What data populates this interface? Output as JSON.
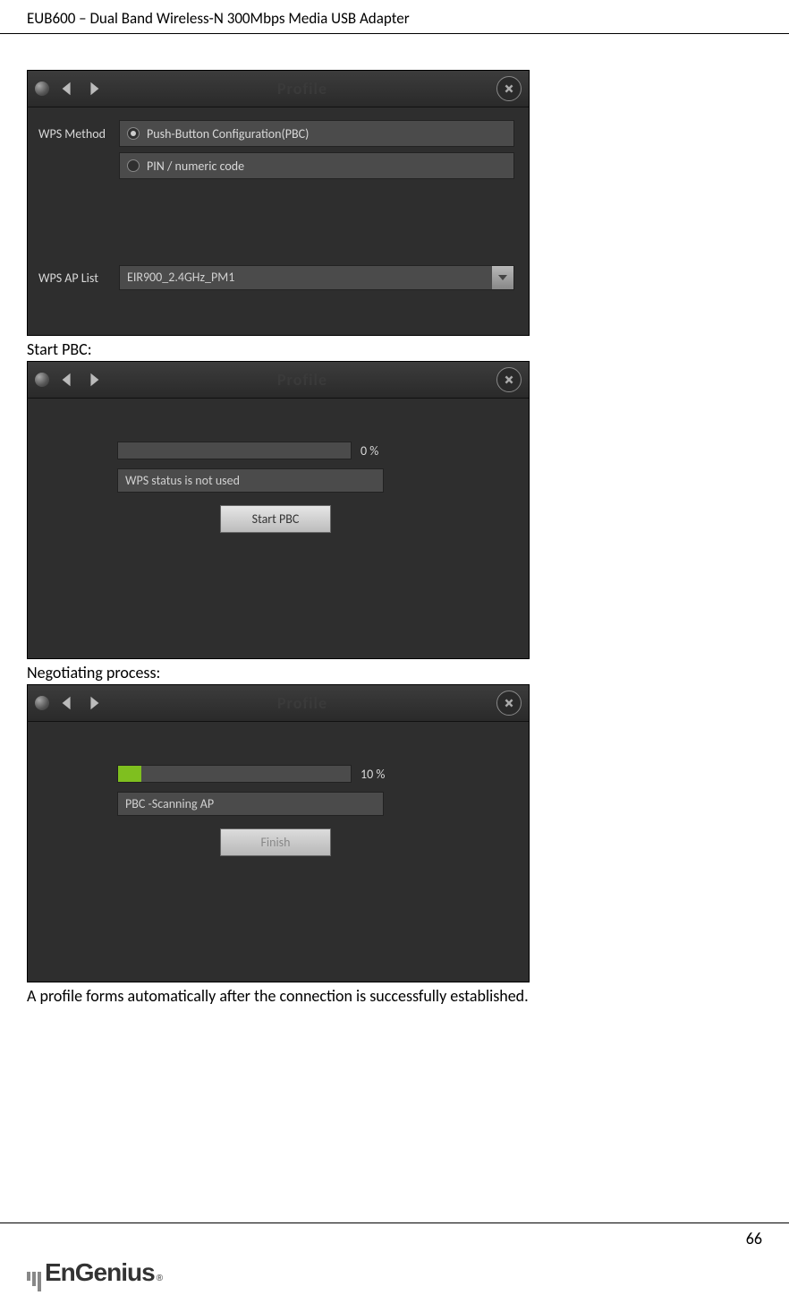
{
  "pageHeader": "EUB600 – Dual Band Wireless-N 300Mbps Media USB Adapter",
  "pageNumber": "66",
  "logoText": "EnGenius",
  "logoReg": "®",
  "panelTitle": "Profile",
  "panel1": {
    "wpsMethodLabel": "WPS Method",
    "optionPBC": "Push-Button Configuration(PBC)",
    "optionPIN": "PIN / numeric code",
    "apListLabel": "WPS AP List",
    "apSelected": "EIR900_2.4GHz_PM1"
  },
  "caption1": "Start PBC:",
  "panel2": {
    "progressText": "0 %",
    "progressPercent": 0,
    "statusText": "WPS status is not used",
    "buttonLabel": "Start PBC"
  },
  "caption2": "Negotiating process:",
  "panel3": {
    "progressText": "10 %",
    "progressPercent": 10,
    "statusText": "PBC -Scanning AP",
    "buttonLabel": "Finish"
  },
  "footnote": "A profile forms automatically after the connection is successfully established."
}
